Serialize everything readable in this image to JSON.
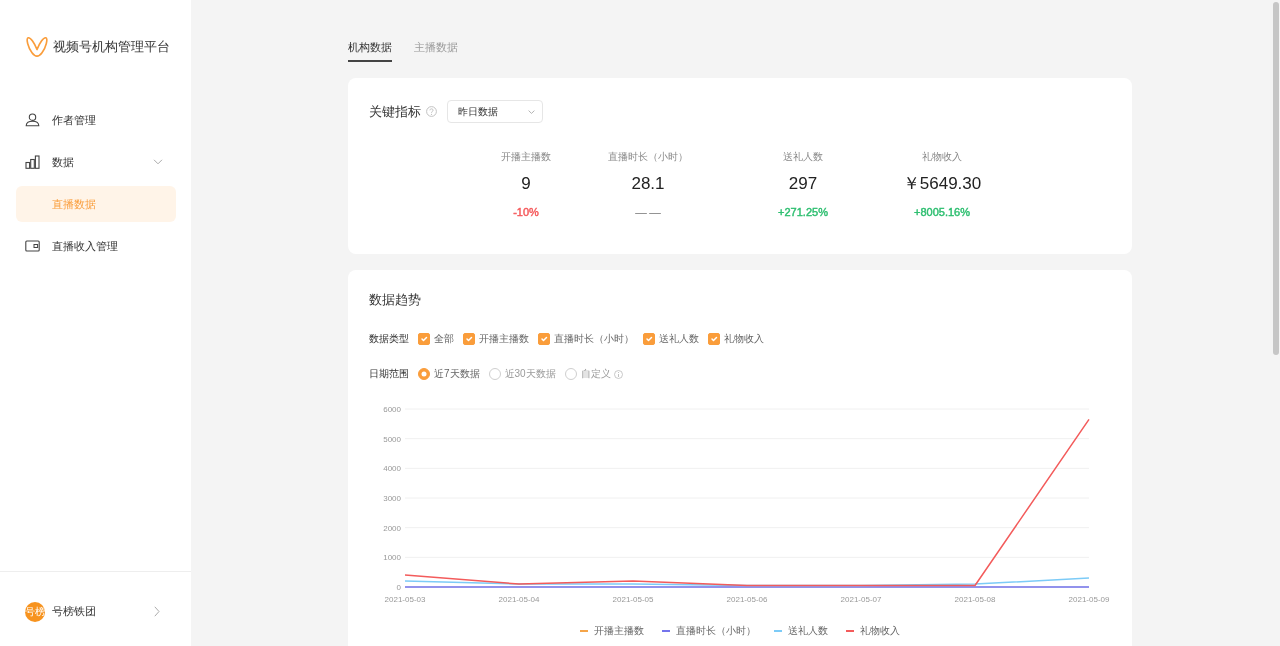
{
  "sidebar": {
    "app_title": "视频号机构管理平台",
    "menu": [
      {
        "label": "作者管理",
        "selected": false
      },
      {
        "label": "数据",
        "selected": false,
        "expanded": true,
        "children": [
          {
            "label": "直播数据",
            "selected": true
          }
        ]
      },
      {
        "label": "直播收入管理",
        "selected": false
      }
    ],
    "account": {
      "avatar_text": "号榜",
      "name": "号榜铁团"
    }
  },
  "tabs": [
    {
      "label": "机构数据",
      "selected": true
    },
    {
      "label": "主播数据",
      "selected": false
    }
  ],
  "key_metrics": {
    "title": "关键指标",
    "period_select": {
      "value": "昨日数据"
    },
    "metrics": [
      {
        "label": "开播主播数",
        "value": "9",
        "change": "-10%",
        "color": "#f5595b"
      },
      {
        "label": "直播时长（小时）",
        "value": "28.1",
        "change": "— —",
        "color": "#888888"
      },
      {
        "label": "送礼人数",
        "value": "297",
        "change": "+271.25%",
        "color": "#2fbf71"
      },
      {
        "label": "礼物收入",
        "value": "￥5649.30",
        "change": "+8005.16%",
        "color": "#2fbf71"
      }
    ]
  },
  "trend": {
    "title": "数据趋势",
    "data_type": {
      "label": "数据类型",
      "options": [
        {
          "label": "全部",
          "checked": true
        },
        {
          "label": "开播主播数",
          "checked": true
        },
        {
          "label": "直播时长（小时）",
          "checked": true
        },
        {
          "label": "送礼人数",
          "checked": true
        },
        {
          "label": "礼物收入",
          "checked": true
        }
      ]
    },
    "date_range": {
      "label": "日期范围",
      "options": [
        {
          "label": "近7天数据",
          "selected": true,
          "info": false
        },
        {
          "label": "近30天数据",
          "selected": false,
          "info": false
        },
        {
          "label": "自定义",
          "selected": false,
          "info": true
        }
      ]
    },
    "chart_data": {
      "type": "line",
      "grid": true,
      "categories": [
        "2021-05-03",
        "2021-05-04",
        "2021-05-05",
        "2021-05-06",
        "2021-05-07",
        "2021-05-08",
        "2021-05-09"
      ],
      "series": [
        {
          "name": "开播主播数",
          "color": "#f5a54a",
          "values": [
            null,
            null,
            null,
            null,
            null,
            null,
            null
          ]
        },
        {
          "name": "直播时长（小时）",
          "color": "#7474ec",
          "values": [
            0,
            0,
            0,
            0,
            0,
            0,
            0
          ]
        },
        {
          "name": "送礼人数",
          "color": "#7ccbf7",
          "values": [
            200,
            100,
            100,
            50,
            50,
            100,
            300
          ]
        },
        {
          "name": "礼物收入",
          "color": "#f35b5b",
          "values": [
            400,
            100,
            200,
            50,
            50,
            50,
            5650
          ]
        }
      ],
      "ylim": [
        0,
        6000
      ],
      "yticks": [
        0,
        1000,
        2000,
        3000,
        4000,
        5000,
        6000
      ]
    }
  }
}
